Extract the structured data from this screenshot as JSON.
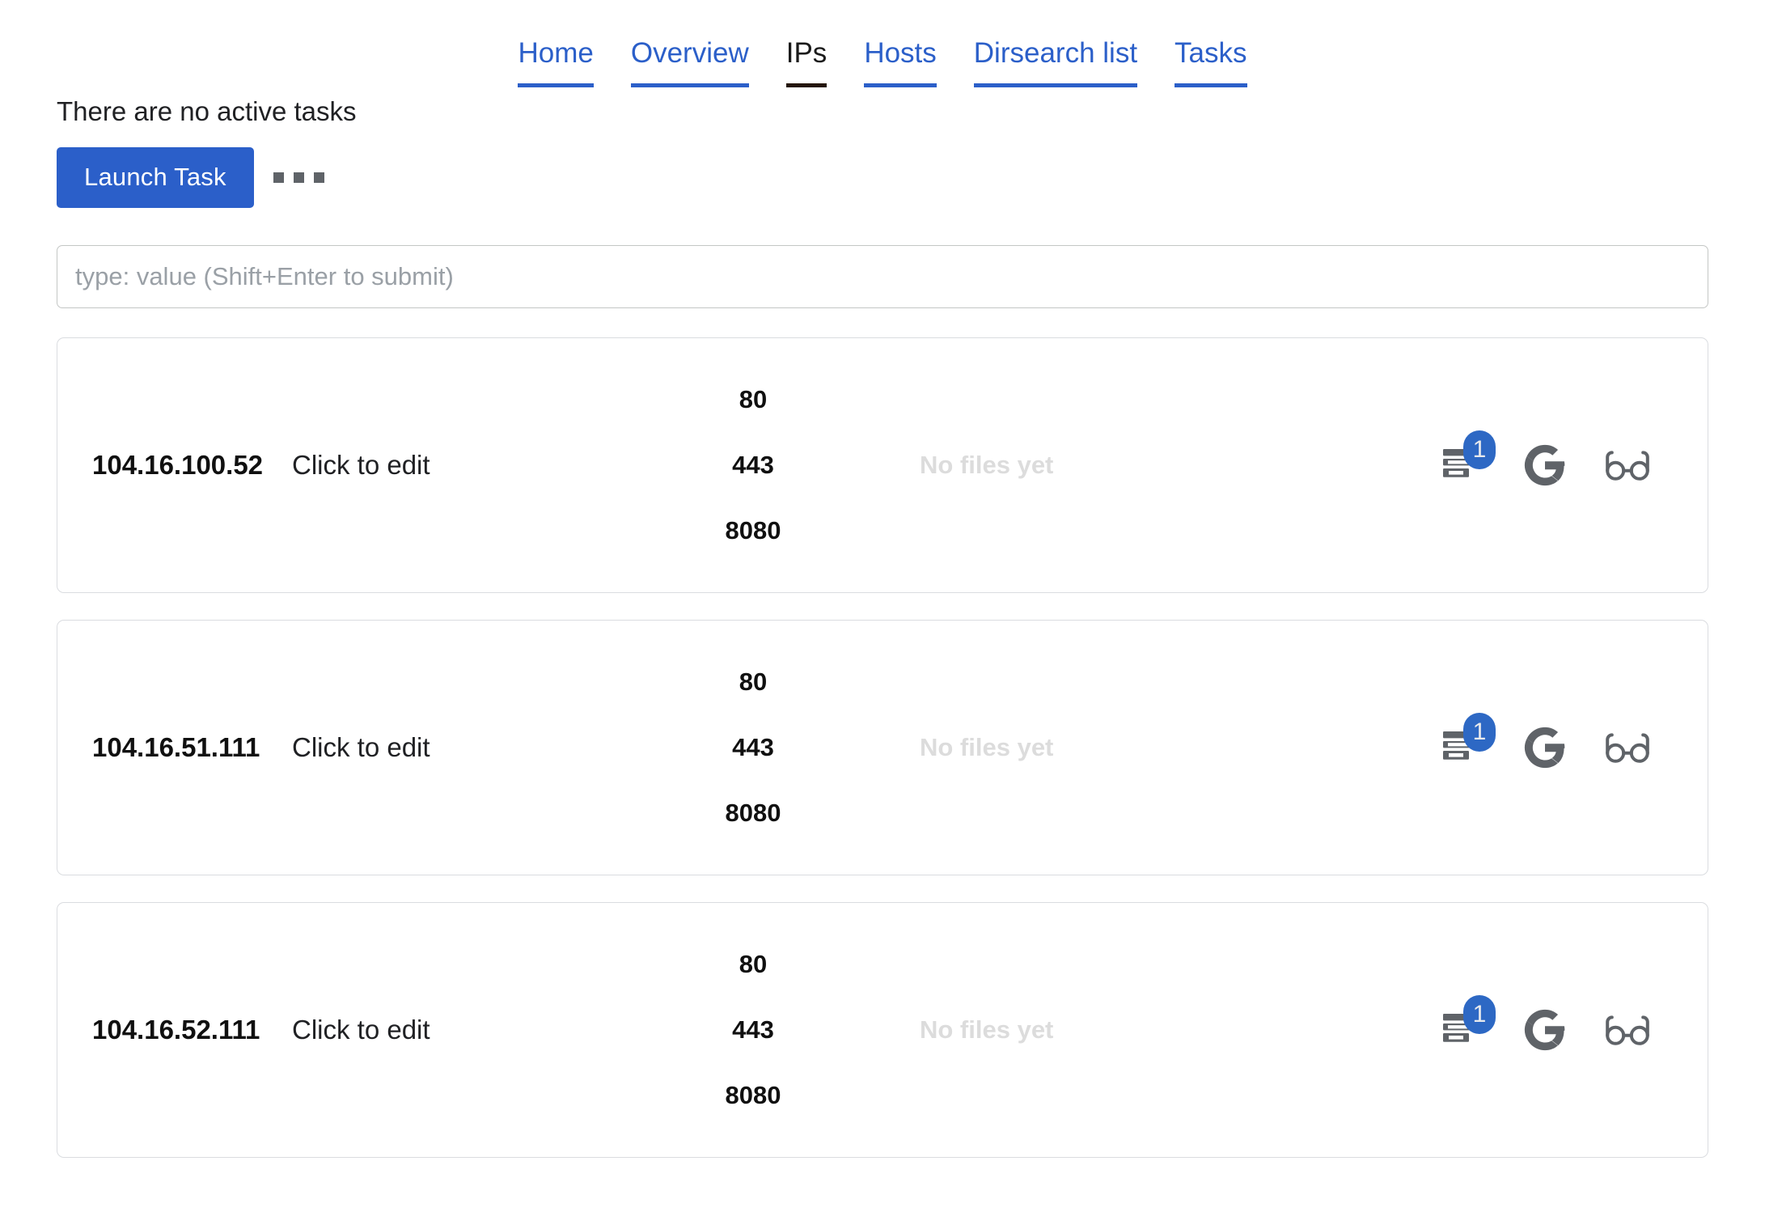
{
  "nav": {
    "items": [
      {
        "label": "Home",
        "active": false
      },
      {
        "label": "Overview",
        "active": false
      },
      {
        "label": "IPs",
        "active": true
      },
      {
        "label": "Hosts",
        "active": false
      },
      {
        "label": "Dirsearch list",
        "active": false
      },
      {
        "label": "Tasks",
        "active": false
      }
    ]
  },
  "tasks": {
    "status_text": "There are no active tasks",
    "launch_label": "Launch Task",
    "more_menu_label": "..."
  },
  "search": {
    "value": "",
    "placeholder": "type: value (Shift+Enter to submit)"
  },
  "colors": {
    "accent_blue": "#2b5fc9",
    "badge_blue": "#2d68c4",
    "icon_gray": "#5f6368",
    "muted_text": "#dcdcdc",
    "card_border": "#dadce0",
    "active_tab": "#1b1b1b"
  },
  "icons": {
    "notes": "dns-icon",
    "google": "google-g-icon",
    "glasses": "glasses-icon"
  },
  "rows": [
    {
      "ip": "104.16.100.52",
      "edit_label": "Click to edit",
      "ports": [
        "80",
        "443",
        "8080"
      ],
      "files_label": "No files yet",
      "notes_badge": "1"
    },
    {
      "ip": "104.16.51.111",
      "edit_label": "Click to edit",
      "ports": [
        "80",
        "443",
        "8080"
      ],
      "files_label": "No files yet",
      "notes_badge": "1"
    },
    {
      "ip": "104.16.52.111",
      "edit_label": "Click to edit",
      "ports": [
        "80",
        "443",
        "8080"
      ],
      "files_label": "No files yet",
      "notes_badge": "1"
    }
  ]
}
